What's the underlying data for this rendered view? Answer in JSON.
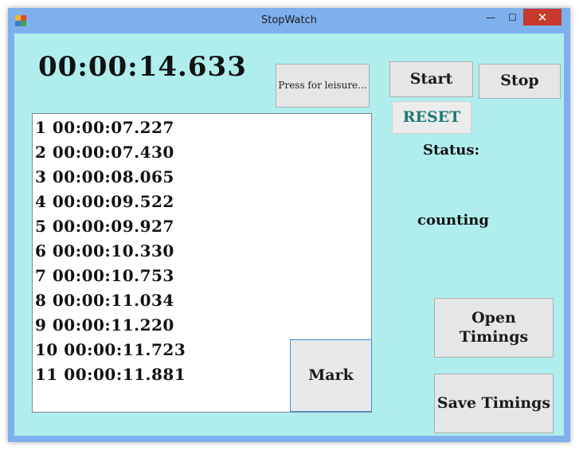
{
  "window": {
    "title": "StopWatch",
    "controls": {
      "minimize": "—",
      "maximize": "☐",
      "close": "✕"
    }
  },
  "timer": {
    "display": "00:00:14.633"
  },
  "buttons": {
    "leisure": "Press for leisure...",
    "start": "Start",
    "stop": "Stop",
    "reset": "RESET",
    "mark": "Mark",
    "open": "Open Timings",
    "save": "Save Timings"
  },
  "status": {
    "label": "Status:",
    "value": "counting"
  },
  "marks": [
    "1 00:00:07.227",
    "2 00:00:07.430",
    "3 00:00:08.065",
    "4 00:00:09.522",
    "5 00:00:09.927",
    "6 00:00:10.330",
    "7 00:00:10.753",
    "8 00:00:11.034",
    "9 00:00:11.220",
    "10 00:00:11.723",
    "11 00:00:11.881"
  ],
  "colors": {
    "client_background": "#b0eeee",
    "frame": "#7fb0ee",
    "close_button": "#c7392c",
    "reset_text": "#1c7a7a"
  },
  "icons": {
    "app": "app-window-icon"
  }
}
